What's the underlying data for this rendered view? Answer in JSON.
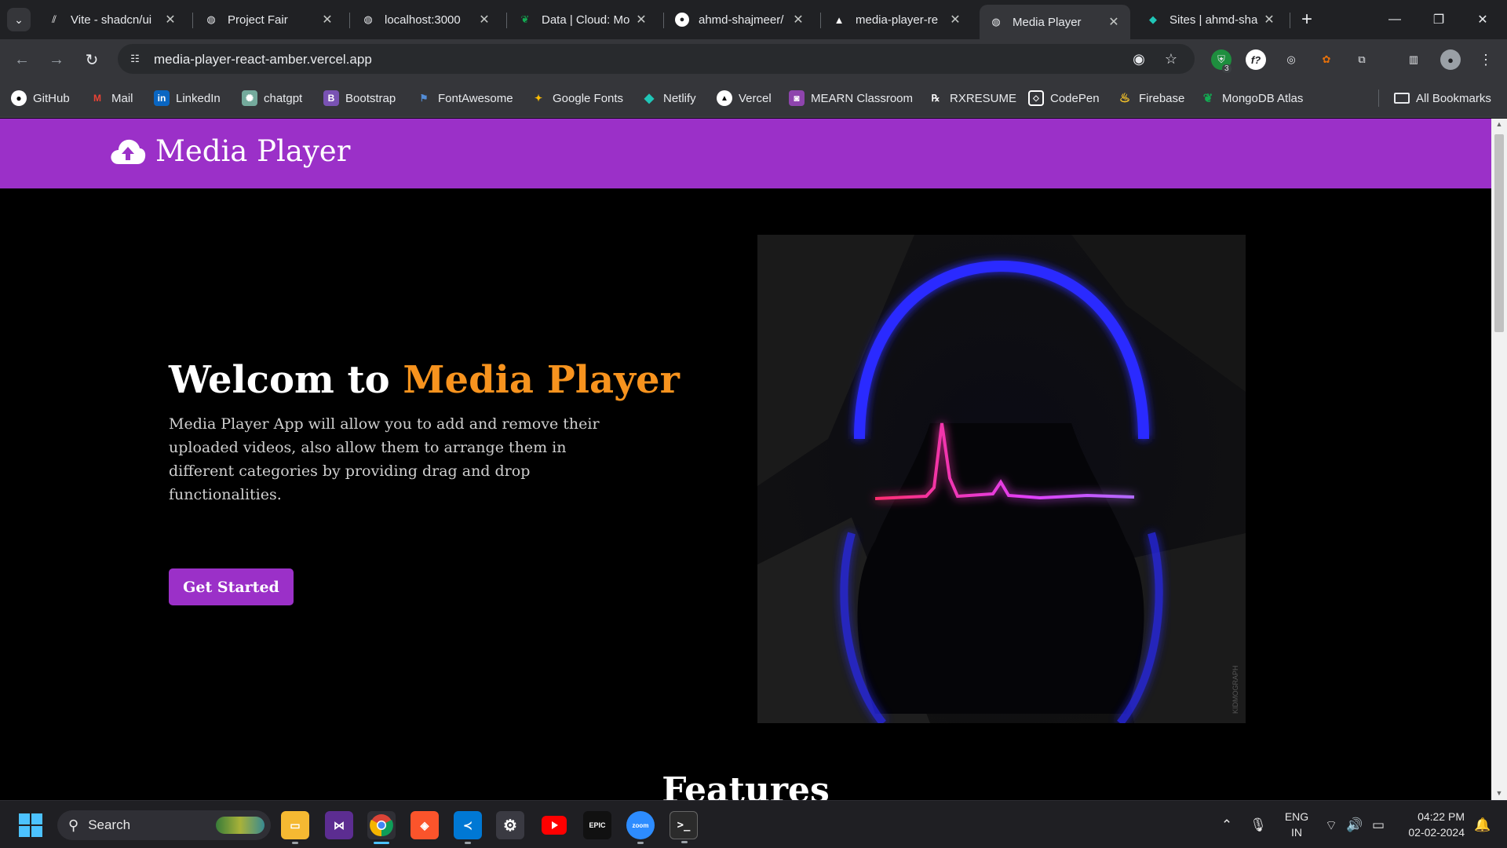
{
  "browser": {
    "tabs": [
      {
        "title": "Vite - shadcn/ui",
        "icon": "vite-icon"
      },
      {
        "title": "Project Fair",
        "icon": "globe-icon"
      },
      {
        "title": "localhost:3000",
        "icon": "globe-icon"
      },
      {
        "title": "Data | Cloud: Mo",
        "icon": "mongodb-leaf-icon"
      },
      {
        "title": "ahmd-shajmeer/",
        "icon": "github-icon"
      },
      {
        "title": "media-player-re",
        "icon": "vercel-icon"
      },
      {
        "title": "Media Player",
        "icon": "globe-icon",
        "active": true
      },
      {
        "title": "Sites | ahmd-sha",
        "icon": "netlify-icon"
      }
    ],
    "url": "media-player-react-amber.vercel.app",
    "bookmarks": [
      {
        "label": "GitHub",
        "icon": "github-icon"
      },
      {
        "label": "Mail",
        "icon": "gmail-icon"
      },
      {
        "label": "LinkedIn",
        "icon": "linkedin-icon"
      },
      {
        "label": "chatgpt",
        "icon": "chatgpt-icon"
      },
      {
        "label": "Bootstrap",
        "icon": "bootstrap-icon"
      },
      {
        "label": "FontAwesome",
        "icon": "flag-icon"
      },
      {
        "label": "Google Fonts",
        "icon": "google-fonts-icon"
      },
      {
        "label": "Netlify",
        "icon": "netlify-icon"
      },
      {
        "label": "Vercel",
        "icon": "vercel-icon"
      },
      {
        "label": "MEARN Classroom",
        "icon": "classroom-icon"
      },
      {
        "label": "RXRESUME",
        "icon": "rx-icon"
      },
      {
        "label": "CodePen",
        "icon": "codepen-icon"
      },
      {
        "label": "Firebase",
        "icon": "firebase-icon"
      },
      {
        "label": "MongoDB Atlas",
        "icon": "mongodb-leaf-icon"
      }
    ],
    "all_bookmarks": "All Bookmarks",
    "extension_badge": "3"
  },
  "page": {
    "brand": "Media Player",
    "hero": {
      "title_prefix": "Welcom to",
      "title_accent": "Media Player",
      "description": "Media Player App will allow you to add and remove their uploaded videos, also allow them to arrange them in different categories by providing drag and drop functionalities.",
      "cta": "Get Started"
    },
    "image_watermark": "KIDMOGRAPH",
    "features_title": "Features"
  },
  "taskbar": {
    "search_placeholder": "Search",
    "apps": [
      "file-explorer-icon",
      "visual-studio-icon",
      "chrome-icon",
      "brave-icon",
      "vscode-icon",
      "settings-icon",
      "youtube-icon",
      "epic-games-icon",
      "zoom-icon",
      "terminal-icon"
    ],
    "epic_label": "EPIC",
    "zoom_label": "zoom",
    "lang_line1": "ENG",
    "lang_line2": "IN",
    "time": "04:22 PM",
    "date": "02-02-2024"
  },
  "colors": {
    "brand_purple": "#9b30c8",
    "accent_orange": "#f7931e",
    "page_bg": "#000000"
  }
}
